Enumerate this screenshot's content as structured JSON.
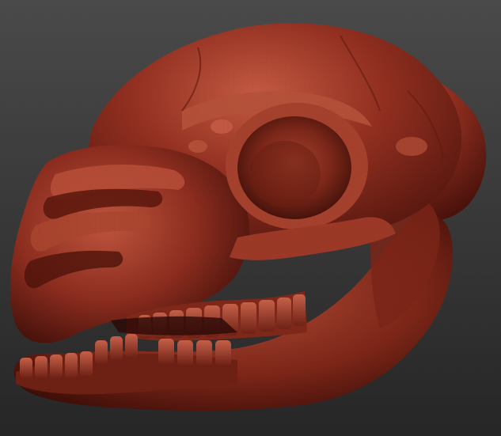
{
  "scene": {
    "subject": "skull-sculpt",
    "colors": {
      "background_top": "#4a4a4a",
      "background_bottom": "#262626",
      "clay": "#8a2e1f",
      "clay_light": "#b8503a",
      "clay_dark": "#4f140c",
      "clay_shadow": "#2a0906"
    }
  }
}
